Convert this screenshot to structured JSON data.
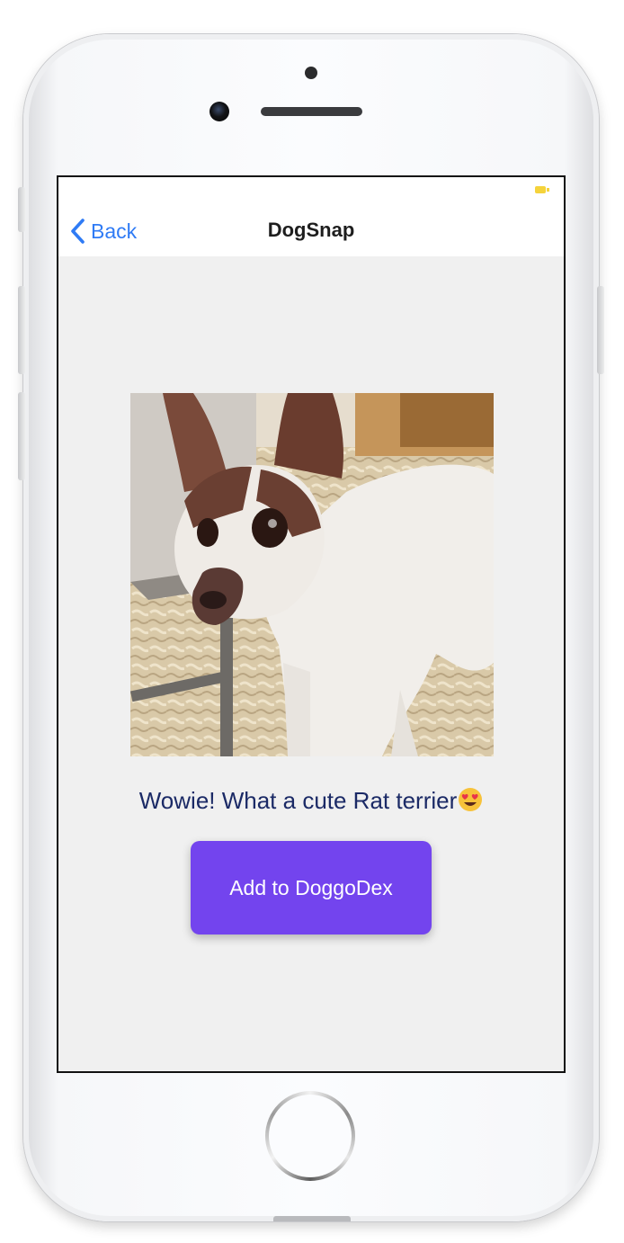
{
  "app": {
    "title": "DogSnap"
  },
  "nav": {
    "back_label": "Back",
    "back_icon": "chevron-left-icon",
    "title": "DogSnap"
  },
  "status_bar": {
    "battery_icon": "battery-charging-icon",
    "battery_color": "#f5d33b"
  },
  "content": {
    "photo_subject": "dog-photo",
    "message": "Wowie! What a cute Rat terrier",
    "message_emoji_icon": "heart-eyes-emoji-icon",
    "add_button_label": "Add to DoggoDex"
  },
  "colors": {
    "accent": "#2f7bf5",
    "button": "#7344ee",
    "message_text": "#1b2a66",
    "background": "#f0f0f0"
  }
}
